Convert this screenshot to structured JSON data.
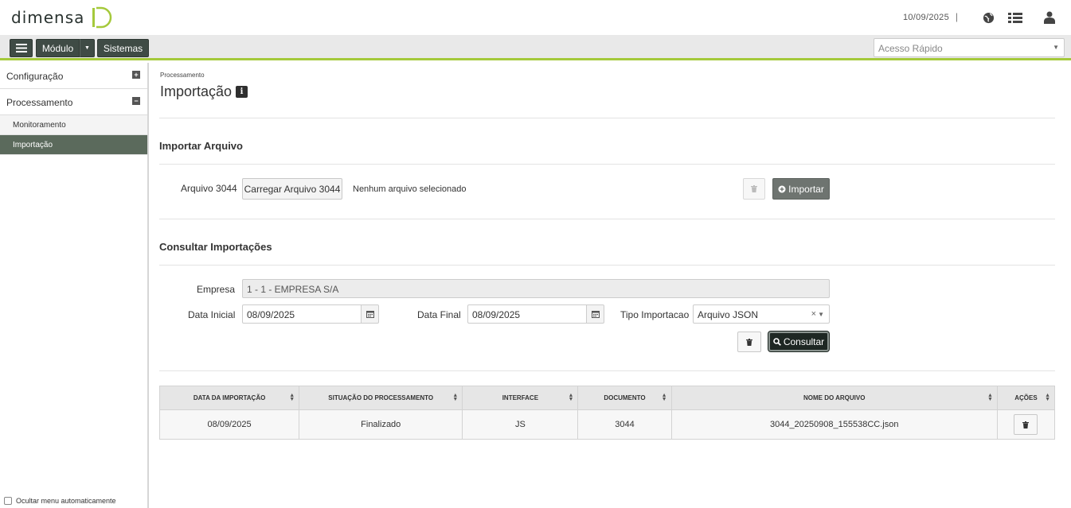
{
  "header": {
    "logo_text": "DIMENSA",
    "date": "10/09/2025",
    "separator": "|",
    "icons": [
      "globe-icon",
      "list-icon",
      "user-icon"
    ]
  },
  "toolbar": {
    "modulo_label": "Módulo",
    "sistemas_label": "Sistemas",
    "quick_access_placeholder": "Acesso Rápido"
  },
  "sidebar": {
    "items": [
      {
        "label": "Configuração",
        "toggle": "+"
      },
      {
        "label": "Processamento",
        "toggle": "−"
      }
    ],
    "subitems": [
      {
        "label": "Monitoramento",
        "active": false
      },
      {
        "label": "Importação",
        "active": true
      }
    ],
    "footer_label": "Ocultar menu automaticamente"
  },
  "page": {
    "breadcrumb": "Processamento",
    "title": "Importação",
    "info_glyph": "i"
  },
  "import_section": {
    "title": "Importar Arquivo",
    "file_label": "Arquivo 3044",
    "upload_button": "Carregar Arquivo 3044",
    "no_file_text": "Nenhum arquivo selecionado",
    "import_button": "Importar"
  },
  "query_section": {
    "title": "Consultar Importações",
    "empresa_label": "Empresa",
    "empresa_value": "1 - 1 - EMPRESA S/A",
    "data_inicial_label": "Data Inicial",
    "data_inicial_value": "08/09/2025",
    "data_final_label": "Data Final",
    "data_final_value": "08/09/2025",
    "tipo_label": "Tipo Importacao",
    "tipo_value": "Arquivo JSON",
    "consultar_button": "Consultar"
  },
  "table": {
    "columns": [
      "DATA DA IMPORTAÇÃO",
      "SITUAÇÃO DO PROCESSAMENTO",
      "INTERFACE",
      "DOCUMENTO",
      "NOME DO ARQUIVO",
      "AÇÕES"
    ],
    "rows": [
      [
        "08/09/2025",
        "Finalizado",
        "JS",
        "3044",
        "3044_20250908_155538CC.json"
      ]
    ]
  },
  "colors": {
    "accent": "#a5c93b",
    "dark_button": "#3f4b45",
    "active_menu": "#5b6a5c"
  }
}
